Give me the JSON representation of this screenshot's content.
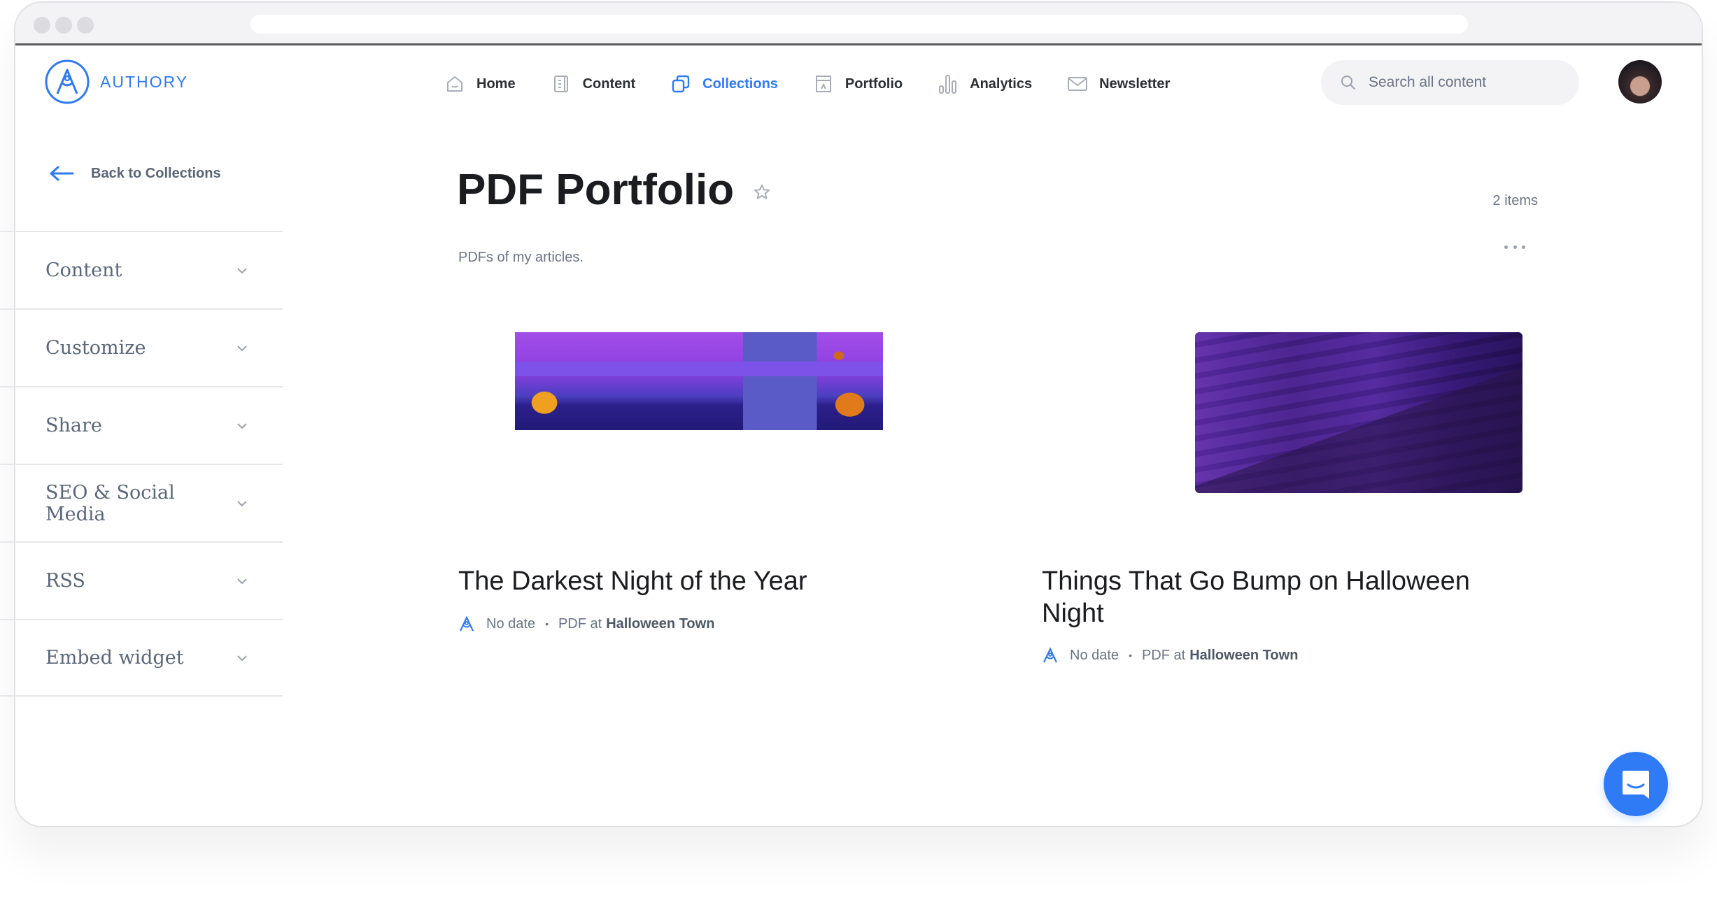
{
  "brand": {
    "name": "AUTHORY",
    "accent": "#2f7af5"
  },
  "nav": {
    "items": [
      {
        "label": "Home",
        "icon": "home-icon",
        "active": false
      },
      {
        "label": "Content",
        "icon": "document-icon",
        "active": false
      },
      {
        "label": "Collections",
        "icon": "collections-icon",
        "active": true
      },
      {
        "label": "Portfolio",
        "icon": "portfolio-icon",
        "active": false
      },
      {
        "label": "Analytics",
        "icon": "bar-chart-icon",
        "active": false
      },
      {
        "label": "Newsletter",
        "icon": "mail-icon",
        "active": false
      }
    ]
  },
  "search": {
    "placeholder": "Search all content",
    "value": ""
  },
  "sidebar": {
    "back_label": "Back to Collections",
    "items": [
      {
        "label": "Content"
      },
      {
        "label": "Customize"
      },
      {
        "label": "Share"
      },
      {
        "label": "SEO & Social Media"
      },
      {
        "label": "RSS"
      },
      {
        "label": "Embed widget"
      }
    ]
  },
  "collection": {
    "title": "PDF Portfolio",
    "description": "PDFs of my articles.",
    "count": "2 items"
  },
  "cards": [
    {
      "title": "The Darkest Night of the Year",
      "date": "No date",
      "type": "PDF at",
      "source": "Halloween Town",
      "separator": "•"
    },
    {
      "title": "Things That Go Bump on Halloween Night",
      "date": "No date",
      "type": "PDF at",
      "source": "Halloween Town",
      "separator": "•"
    }
  ]
}
